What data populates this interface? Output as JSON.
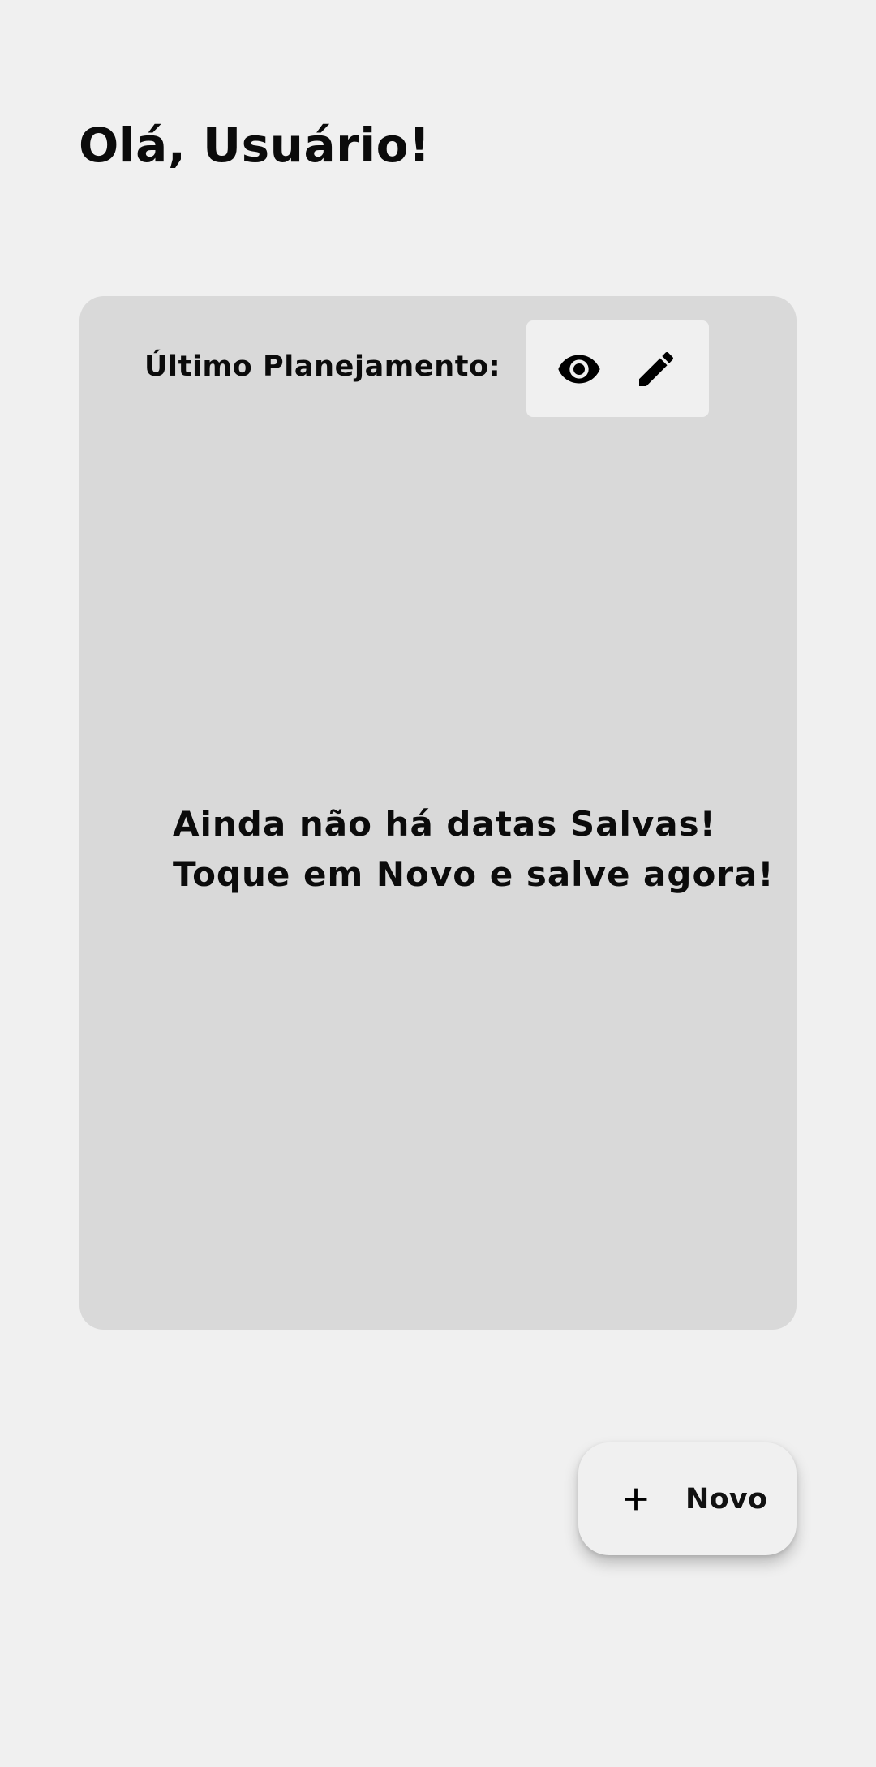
{
  "header": {
    "greeting": "Olá, Usuário!"
  },
  "card": {
    "title": "Último Planejamento:",
    "actions": [
      {
        "icon": "eye-icon",
        "label": "view"
      },
      {
        "icon": "pencil-icon",
        "label": "edit"
      }
    ],
    "empty_message": {
      "line1": "Ainda não há datas Salvas!",
      "line2": "Toque em Novo e salve agora!"
    }
  },
  "fab": {
    "icon": "plus-icon",
    "label": "Novo"
  },
  "colors": {
    "background": "#f0f0f0",
    "card": "#d9d9d9",
    "text": "#0b0b0b"
  }
}
